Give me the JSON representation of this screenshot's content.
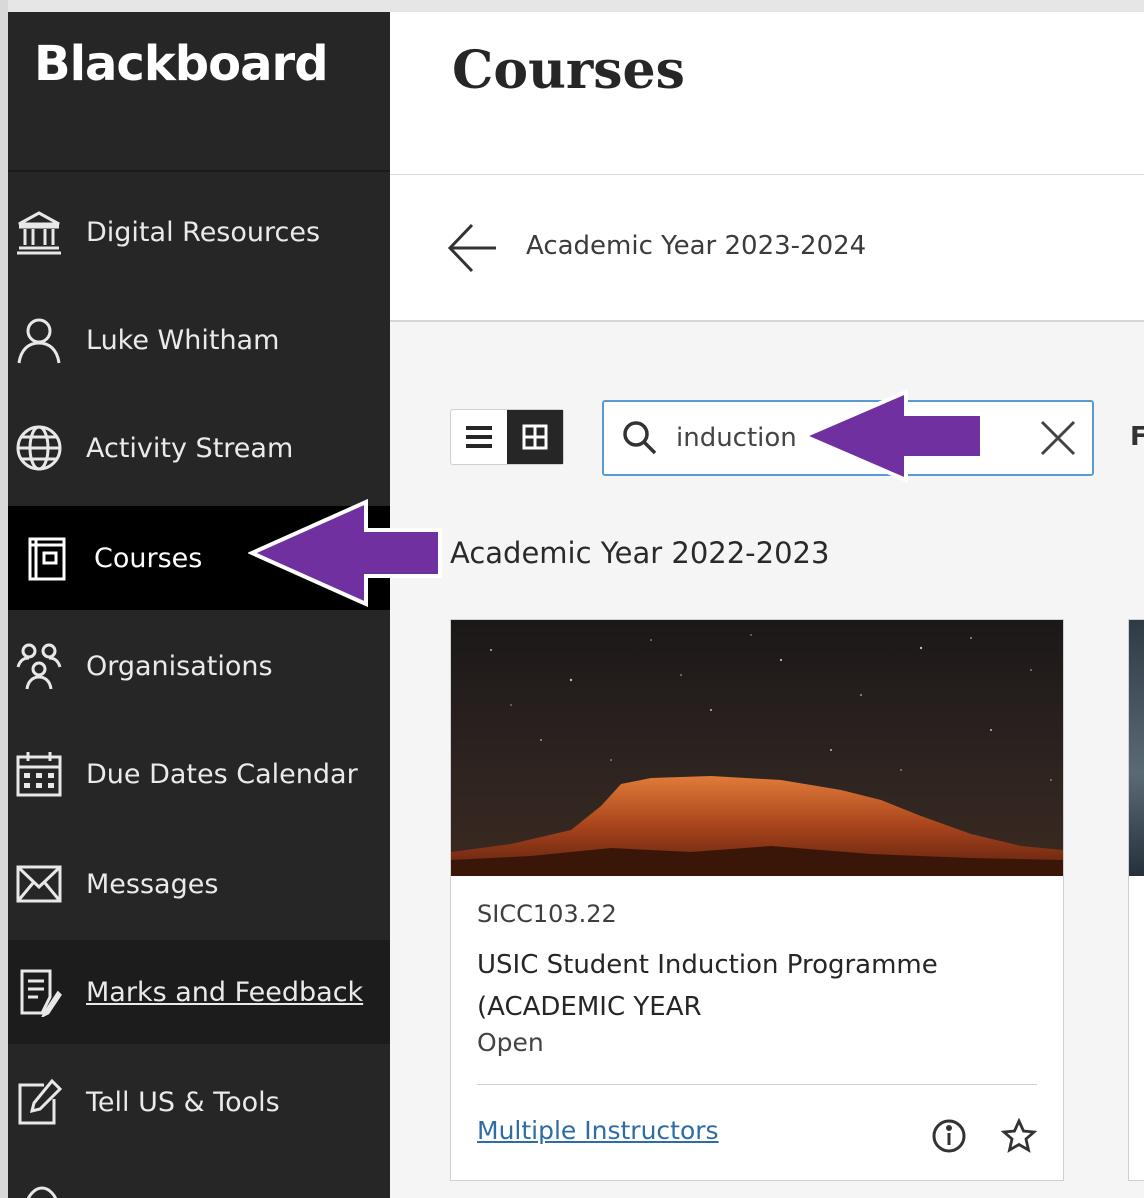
{
  "brand": {
    "logo_text": "Blackboard"
  },
  "sidebar": {
    "items": [
      {
        "label": "Digital Resources",
        "icon": "institution-icon"
      },
      {
        "label": "Luke Whitham",
        "icon": "user-icon"
      },
      {
        "label": "Activity Stream",
        "icon": "globe-icon"
      },
      {
        "label": "Courses",
        "icon": "courses-icon",
        "active": true
      },
      {
        "label": "Organisations",
        "icon": "organisations-icon"
      },
      {
        "label": "Due Dates Calendar",
        "icon": "calendar-icon"
      },
      {
        "label": "Messages",
        "icon": "envelope-icon"
      },
      {
        "label": "Marks and Feedback",
        "icon": "marks-icon"
      },
      {
        "label": "Tell US & Tools",
        "icon": "edit-icon"
      }
    ]
  },
  "header": {
    "title": "Courses"
  },
  "term": {
    "label": "Academic Year 2023-2024"
  },
  "search": {
    "value": "induction",
    "placeholder": ""
  },
  "filter_hint": "F",
  "section": {
    "heading": "Academic Year 2022-2023"
  },
  "card": {
    "code": "SICC103.22",
    "title": "USIC Student Induction Programme (ACADEMIC YEAR",
    "status": "Open",
    "instructors_link": "Multiple Instructors"
  },
  "colors": {
    "sidebar_bg": "#262626",
    "active_bg": "#000000",
    "accent_link": "#2e6da4",
    "search_border": "#5b9bd5",
    "arrow_purple": "#7030a0"
  }
}
